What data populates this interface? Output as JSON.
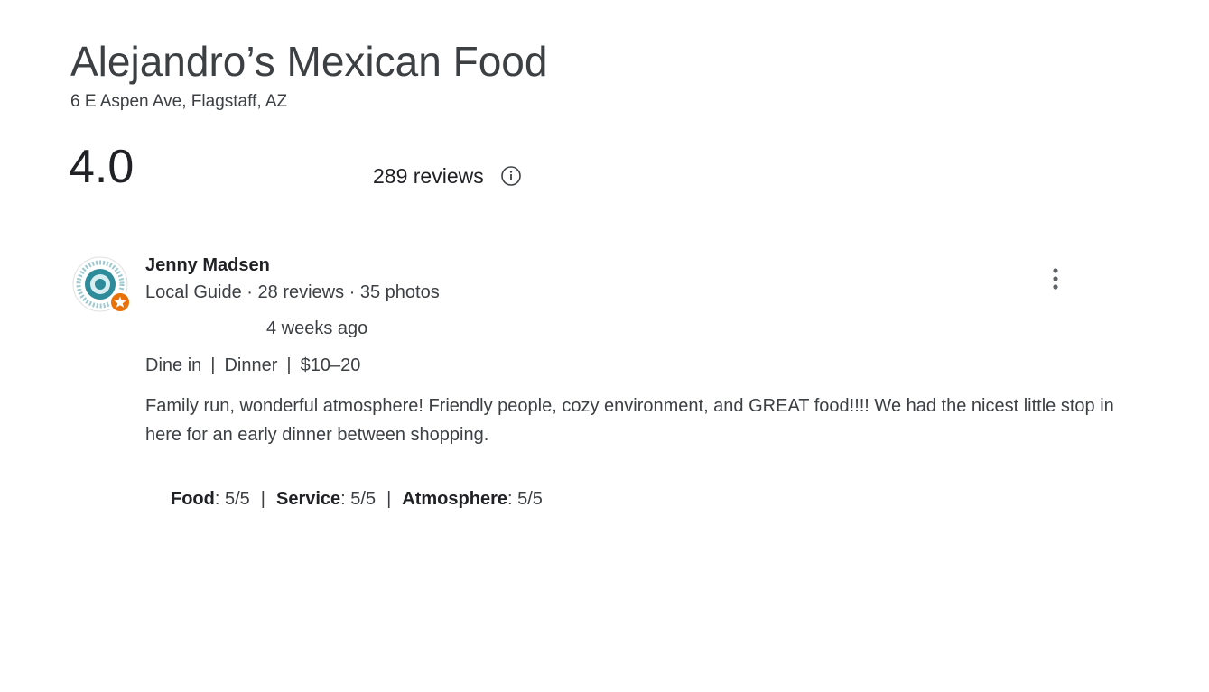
{
  "place": {
    "name": "Alejandro’s Mexican Food",
    "address": "6 E Aspen Ave, Flagstaff, AZ"
  },
  "summary": {
    "rating": "4.0",
    "reviews_count": "289 reviews",
    "info_icon": "info-icon"
  },
  "review": {
    "avatar_icon": "reviewer-avatar-icon",
    "reviewer_name": "Jenny Madsen",
    "reviewer_meta": "Local Guide · 28 reviews · 35 photos",
    "more_icon": "more-vert-icon",
    "time": "4 weeks ago",
    "tags": [
      "Dine in",
      "Dinner",
      "$10–20"
    ],
    "text": "Family run, wonderful atmosphere! Friendly people, cozy environment, and GREAT food!!!! We had the nicest little stop in here for an early dinner between shopping.",
    "subratings": [
      {
        "label": "Food",
        "value": ": 5/5"
      },
      {
        "label": "Service",
        "value": ": 5/5"
      },
      {
        "label": "Atmosphere",
        "value": ": 5/5"
      }
    ]
  },
  "colors": {
    "text_primary": "#202124",
    "text_secondary": "#3c4043",
    "local_guide_badge": "#e8710a",
    "avatar_teal": "#2e8b9a"
  }
}
